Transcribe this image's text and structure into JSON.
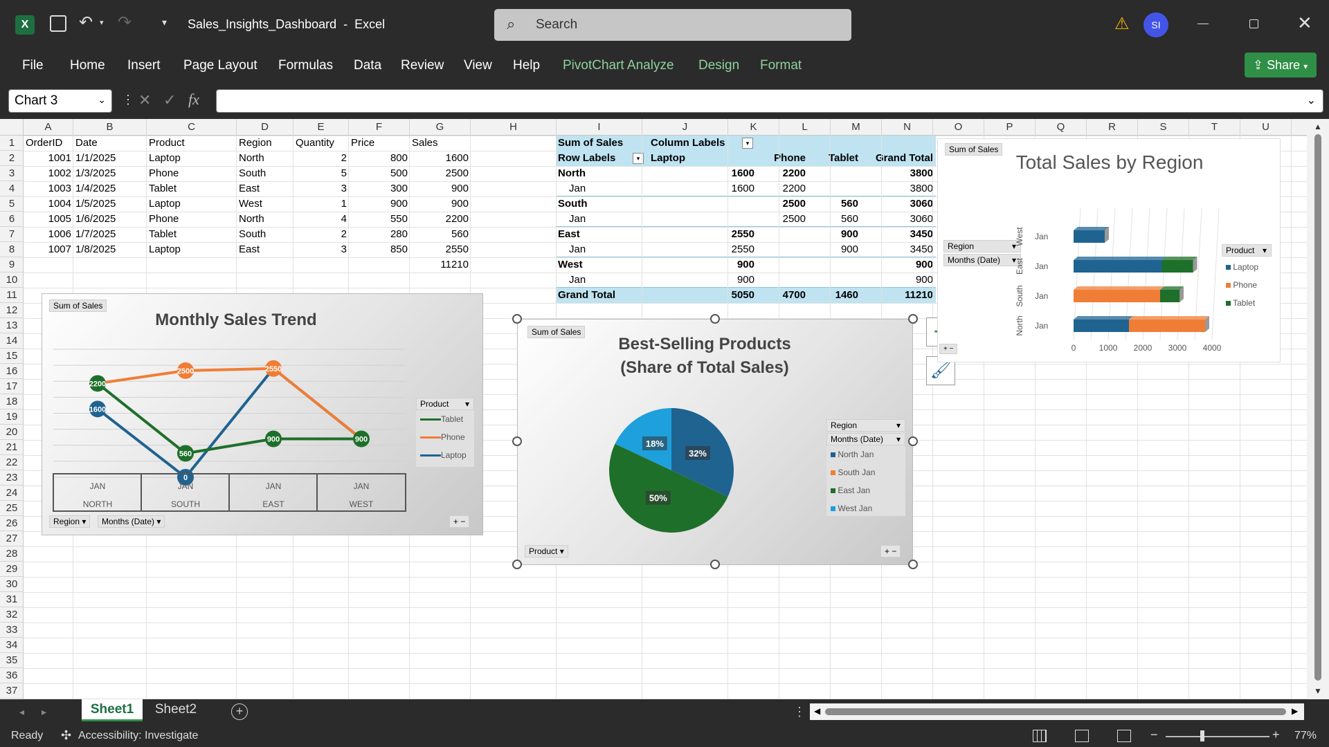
{
  "titlebar": {
    "filename": "Sales_Insights_Dashboard",
    "app": "Excel",
    "search_placeholder": "Search",
    "avatar": "SI"
  },
  "menu": [
    "File",
    "Home",
    "Insert",
    "Page Layout",
    "Formulas",
    "Data",
    "Review",
    "View",
    "Help"
  ],
  "context_menu": [
    "PivotChart Analyze",
    "Design",
    "Format"
  ],
  "share_label": "Share",
  "namebox": "Chart 3",
  "columns": [
    "A",
    "B",
    "C",
    "D",
    "E",
    "F",
    "G",
    "H",
    "I",
    "J",
    "K",
    "L",
    "M",
    "N",
    "O",
    "P",
    "Q",
    "R",
    "S",
    "T",
    "U"
  ],
  "rows": [
    "1",
    "2",
    "3",
    "4",
    "5",
    "6",
    "7",
    "8",
    "9",
    "10",
    "11",
    "12",
    "13",
    "14",
    "15",
    "16",
    "17",
    "18",
    "19",
    "20",
    "21",
    "22",
    "23",
    "24",
    "25",
    "26",
    "27",
    "28",
    "29",
    "30",
    "31",
    "32",
    "33",
    "34",
    "35",
    "36",
    "37"
  ],
  "table": {
    "headers": [
      "OrderID",
      "Date",
      "Product",
      "Region",
      "Quantity",
      "Price",
      "Sales"
    ],
    "rows": [
      [
        "1001",
        "1/1/2025",
        "Laptop",
        "North",
        "2",
        "800",
        "1600"
      ],
      [
        "1002",
        "1/3/2025",
        "Phone",
        "South",
        "5",
        "500",
        "2500"
      ],
      [
        "1003",
        "1/4/2025",
        "Tablet",
        "East",
        "3",
        "300",
        "900"
      ],
      [
        "1004",
        "1/5/2025",
        "Laptop",
        "West",
        "1",
        "900",
        "900"
      ],
      [
        "1005",
        "1/6/2025",
        "Phone",
        "North",
        "4",
        "550",
        "2200"
      ],
      [
        "1006",
        "1/7/2025",
        "Tablet",
        "South",
        "2",
        "280",
        "560"
      ],
      [
        "1007",
        "1/8/2025",
        "Laptop",
        "East",
        "3",
        "850",
        "2550"
      ]
    ],
    "total": "11210"
  },
  "pivot": {
    "sum_label": "Sum of Sales",
    "col_labels": "Column Labels",
    "row_labels": "Row Labels",
    "col_headers": [
      "Laptop",
      "Phone",
      "Tablet",
      "Grand Total"
    ],
    "rows": [
      {
        "label": "North",
        "bold": true,
        "vals": [
          "1600",
          "2200",
          "",
          "3800"
        ]
      },
      {
        "label": "Jan",
        "bold": false,
        "vals": [
          "1600",
          "2200",
          "",
          "3800"
        ]
      },
      {
        "label": "South",
        "bold": true,
        "vals": [
          "",
          "2500",
          "560",
          "3060"
        ]
      },
      {
        "label": "Jan",
        "bold": false,
        "vals": [
          "",
          "2500",
          "560",
          "3060"
        ]
      },
      {
        "label": "East",
        "bold": true,
        "vals": [
          "2550",
          "",
          "900",
          "3450"
        ]
      },
      {
        "label": "Jan",
        "bold": false,
        "vals": [
          "2550",
          "",
          "900",
          "3450"
        ]
      },
      {
        "label": "West",
        "bold": true,
        "vals": [
          "900",
          "",
          "",
          "900"
        ]
      },
      {
        "label": "Jan",
        "bold": false,
        "vals": [
          "900",
          "",
          "",
          "900"
        ]
      }
    ],
    "grand_total": {
      "label": "Grand Total",
      "vals": [
        "5050",
        "4700",
        "1460",
        "11210"
      ]
    }
  },
  "colors": {
    "laptop": "#1f6391",
    "phone": "#f07d36",
    "tablet": "#1e6f2a",
    "west": "#1ea0dc"
  },
  "line_chart": {
    "sum_label": "Sum of Sales",
    "title": "Monthly Sales Trend",
    "legend_title": "Product",
    "region_btn": "Region",
    "months_btn": "Months (Date)",
    "months": [
      "JAN",
      "JAN",
      "JAN",
      "JAN"
    ],
    "regions": [
      "NORTH",
      "SOUTH",
      "EAST",
      "WEST"
    ],
    "chart_data": {
      "type": "line",
      "categories": [
        "Jan North",
        "Jan South",
        "Jan East",
        "Jan West"
      ],
      "series": [
        {
          "name": "Tablet",
          "values": [
            2200,
            560,
            900,
            900
          ],
          "labels": [
            "2200",
            "560",
            "900",
            "900"
          ]
        },
        {
          "name": "Phone",
          "values": [
            2200,
            2500,
            2550,
            900
          ],
          "labels": [
            "",
            "2500",
            "2550",
            ""
          ]
        },
        {
          "name": "Laptop",
          "values": [
            1600,
            0,
            2550,
            900
          ],
          "labels": [
            "1600",
            "0",
            "",
            ""
          ]
        }
      ],
      "ylim": [
        0,
        3000
      ]
    }
  },
  "pie_chart": {
    "sum_label": "Sum of Sales",
    "title_line1": "Best-Selling Products",
    "title_line2": "(Share of Total Sales)",
    "product_btn": "Product",
    "region_btn": "Region",
    "months_btn": "Months (Date)",
    "chart_data": {
      "type": "pie",
      "slices": [
        {
          "name": "North Jan",
          "value": 32,
          "label": "32%"
        },
        {
          "name": "South Jan",
          "value": 50,
          "label": "50%"
        },
        {
          "name": "East Jan",
          "value": 0,
          "label": ""
        },
        {
          "name": "West Jan",
          "value": 18,
          "label": "18%"
        }
      ]
    }
  },
  "bar_chart": {
    "sum_label": "Sum of Sales",
    "title": "Total Sales by Region",
    "region_btn": "Region",
    "months_btn": "Months (Date)",
    "legend_title": "Product",
    "chart_data": {
      "type": "bar",
      "categories": [
        "North",
        "South",
        "East",
        "West"
      ],
      "category_sub": [
        "Jan",
        "Jan",
        "Jan",
        "Jan"
      ],
      "series": [
        {
          "name": "Laptop",
          "values": [
            1600,
            0,
            2550,
            900
          ]
        },
        {
          "name": "Phone",
          "values": [
            2200,
            2500,
            0,
            0
          ]
        },
        {
          "name": "Tablet",
          "values": [
            0,
            560,
            900,
            0
          ]
        }
      ],
      "xticks": [
        "0",
        "1000",
        "2000",
        "3000",
        "4000"
      ],
      "xlim": [
        0,
        4000
      ]
    }
  },
  "sheets": [
    "Sheet1",
    "Sheet2"
  ],
  "status": {
    "ready": "Ready",
    "accessibility": "Accessibility: Investigate",
    "zoom": "77%"
  }
}
